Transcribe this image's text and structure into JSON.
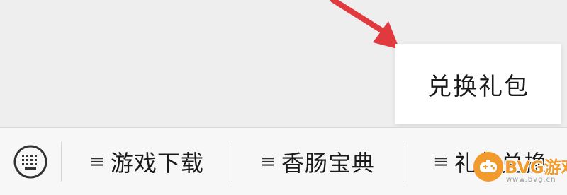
{
  "popup": {
    "item_label": "兑换礼包"
  },
  "bottom_menu": {
    "keyboard_icon": "keyboard-icon",
    "tabs": [
      {
        "label": "游戏下载",
        "icon": "hamburger-icon"
      },
      {
        "label": "香肠宝典",
        "icon": "hamburger-icon"
      },
      {
        "label": "礼包兑换",
        "icon": "hamburger-icon"
      }
    ],
    "hamburger_glyph": "≡"
  },
  "annotation": {
    "arrow_color": "#e03a3e"
  },
  "watermark": {
    "brand": "BVG游戏网",
    "url": "www.bvg.cn",
    "color": "#f29a2b"
  }
}
